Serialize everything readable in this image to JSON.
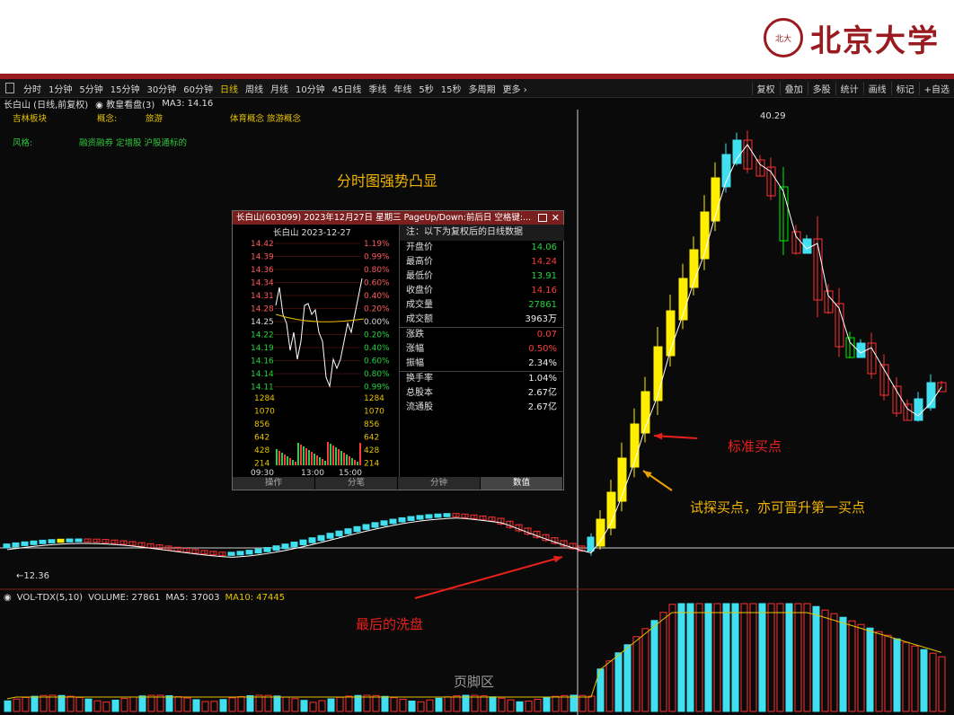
{
  "slide": {
    "logo_text": "北京大学",
    "headline": "分时图强势凸显",
    "annotations": {
      "standard_buy": "标准买点",
      "test_buy": "试探买点，亦可晋升第一买点",
      "last_wash": "最后的洗盘",
      "footer": "页脚区"
    },
    "colors": {
      "brand": "#9a1b1f",
      "bull_yellow": "#ffee00",
      "bull_cyan": "#40e0f0",
      "bear_red": "#ff3030",
      "bear_green": "#00ee00"
    }
  },
  "toolbar": {
    "periods": [
      "分时",
      "1分钟",
      "5分钟",
      "15分钟",
      "30分钟",
      "60分钟",
      "日线",
      "周线",
      "月线",
      "10分钟",
      "45日线",
      "季线",
      "年线",
      "5秒",
      "15秒",
      "多周期",
      "更多 ›"
    ],
    "active": "日线",
    "right_tools": [
      "复权",
      "叠加",
      "多股",
      "统计",
      "画线",
      "标记",
      "+自选"
    ]
  },
  "infobar": {
    "stock": "长白山 (日线,前复权)",
    "indicator": "◉ 教皇看盘(3)",
    "ma3": "MA3: 14.16"
  },
  "categories": {
    "sector_label": "吉林板块",
    "concept_label": "概念:",
    "concept_value": "旅游",
    "sports_label": "体育概念 旅游概念",
    "style_label": "风格:",
    "style_value": "融资融券 定增股 沪股通标的"
  },
  "price_labels": {
    "high": "40.29",
    "low": "←12.36"
  },
  "volume": {
    "label": "VOL-TDX(5,10)",
    "volume": "VOLUME: 27861",
    "ma5": "MA5: 37003",
    "ma10": "MA10: 47445"
  },
  "popup": {
    "title": "长白山(603099) 2023年12月27日 星期三 PageUp/Down:前后日 空格键:...",
    "intraday_header": "长白山   2023-12-27",
    "price_ticks": [
      "14.42",
      "14.39",
      "14.36",
      "14.34",
      "14.31",
      "14.28",
      "14.25",
      "14.22",
      "14.19",
      "14.16",
      "14.14",
      "14.11"
    ],
    "pct_ticks": [
      "1.19%",
      "0.99%",
      "0.80%",
      "0.60%",
      "0.40%",
      "0.20%",
      "0.00%",
      "0.20%",
      "0.40%",
      "0.60%",
      "0.80%",
      "0.99%"
    ],
    "vol_ticks": [
      "1284",
      "1070",
      "856",
      "642",
      "428",
      "214"
    ],
    "time_ticks": [
      "09:30",
      "13:00",
      "15:00"
    ],
    "note": "注：以下为复权后的日线数据",
    "rows": [
      {
        "k": "开盘价",
        "v": "14.06",
        "c": "grn"
      },
      {
        "k": "最高价",
        "v": "14.24",
        "c": "red"
      },
      {
        "k": "最低价",
        "v": "13.91",
        "c": "grn"
      },
      {
        "k": "收盘价",
        "v": "14.16",
        "c": "red"
      },
      {
        "k": "成交量",
        "v": "27861",
        "c": "grn"
      },
      {
        "k": "成交额",
        "v": "3963万",
        "c": "wht"
      }
    ],
    "rows2": [
      {
        "k": "涨跌",
        "v": "0.07",
        "c": "red"
      },
      {
        "k": "涨幅",
        "v": "0.50%",
        "c": "red"
      },
      {
        "k": "振幅",
        "v": "2.34%",
        "c": "wht"
      }
    ],
    "rows3": [
      {
        "k": "换手率",
        "v": "1.04%",
        "c": "wht"
      },
      {
        "k": "总股本",
        "v": "2.67亿",
        "c": "wht"
      },
      {
        "k": "流通股",
        "v": "2.67亿",
        "c": "wht"
      }
    ],
    "tabs": [
      "操作",
      "分笔",
      "分钟",
      "数值"
    ],
    "selected_tab": "数值"
  }
}
